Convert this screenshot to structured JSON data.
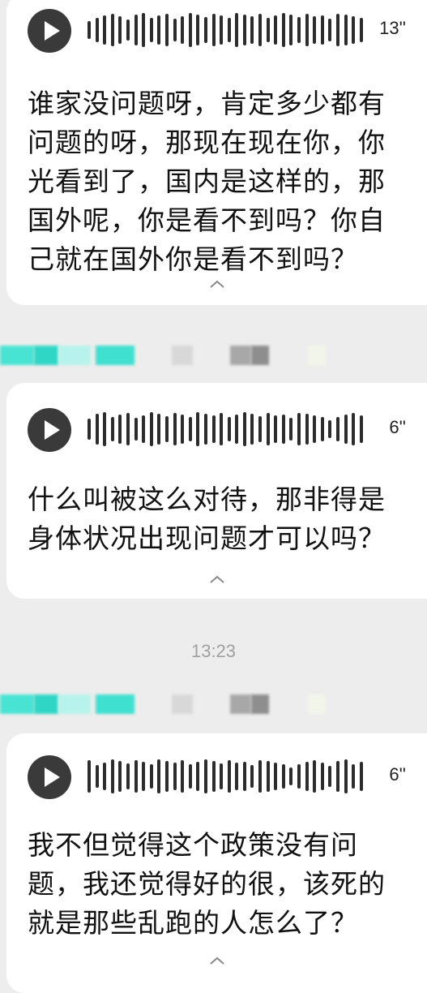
{
  "messages": [
    {
      "duration": "13''",
      "transcript": "谁家没问题呀，肯定多少都有问题的呀，那现在现在你，你光看到了，国内是这样的，那国外呢，你是看不到吗？你自己就在国外你是看不到吗？"
    },
    {
      "duration": "6''",
      "transcript": "什么叫被这么对待，那非得是身体状况出现问题才可以吗？"
    },
    {
      "duration": "6''",
      "transcript": "我不但觉得这个政策没有问题，我还觉得好的很，该死的就是那些乱跑的人怎么了？"
    }
  ],
  "timestamp": "13:23",
  "icons": {
    "play": "play-icon",
    "collapse": "chevron-up-icon",
    "waveform": "waveform-icon"
  },
  "colors": {
    "background": "#ededed",
    "bubble": "#ffffff",
    "play_button": "#3a3a3a",
    "blur_teal": "#3fe0d0"
  }
}
